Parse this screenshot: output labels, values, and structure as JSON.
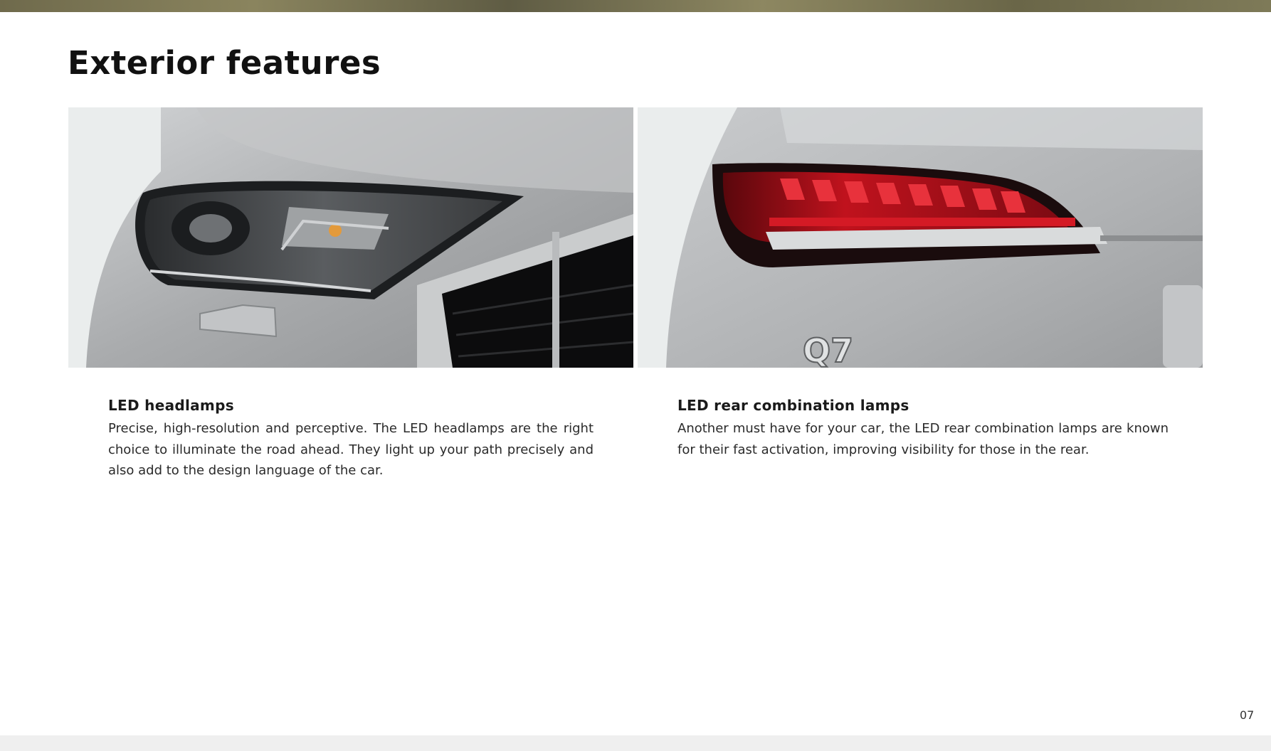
{
  "page": {
    "title": "Exterior features",
    "page_number": "07"
  },
  "features": [
    {
      "heading": "LED headlamps",
      "body": "Precise, high-resolution and perceptive. The LED headlamps are the right choice to illuminate the road ahead. They light up your path precisely and also add to the design language of the car.",
      "image_icon": "car-headlamp-photo"
    },
    {
      "heading": "LED rear combination lamps",
      "body": "Another must have for your car, the LED rear combination lamps are known for their fast activation, improving visibility for those in the rear.",
      "image_icon": "car-taillamp-photo"
    }
  ],
  "photo_badge": "Q7",
  "colors": {
    "body_paint": "#b4b6b8",
    "taillight_red": "#c0121d",
    "background": "#ffffff"
  }
}
